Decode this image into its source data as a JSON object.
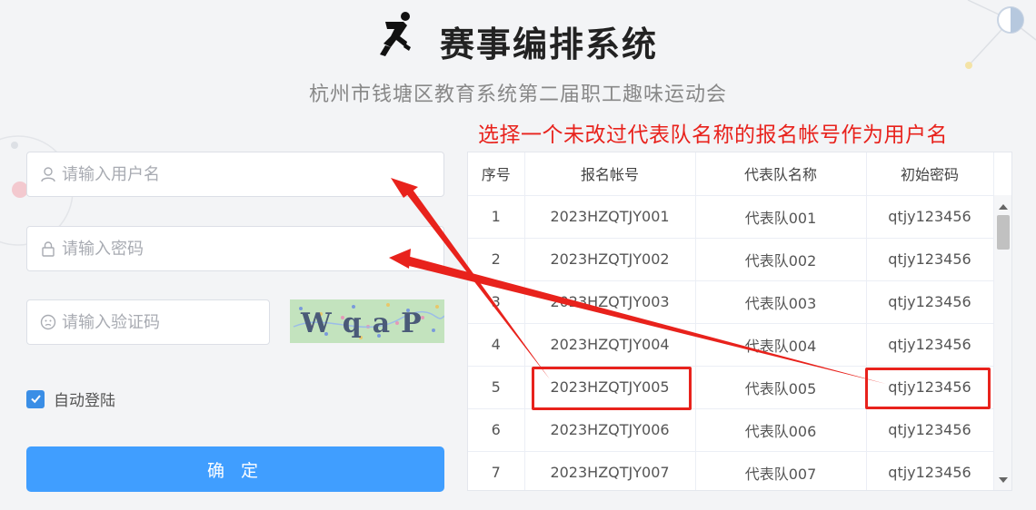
{
  "header": {
    "title": "赛事编排系统",
    "subtitle": "杭州市钱塘区教育系统第二届职工趣味运动会"
  },
  "instruction": "选择一个未改过代表队名称的报名帐号作为用户名",
  "login": {
    "username_placeholder": "请输入用户名",
    "password_placeholder": "请输入密码",
    "captcha_placeholder": "请输入验证码",
    "captcha_text": "WqaP",
    "remember_label": "自动登陆",
    "remember_checked": true,
    "submit_label": "确 定"
  },
  "table": {
    "columns": [
      "序号",
      "报名帐号",
      "代表队名称",
      "初始密码"
    ],
    "rows": [
      [
        "1",
        "2023HZQTJY001",
        "代表队001",
        "qtjy123456"
      ],
      [
        "2",
        "2023HZQTJY002",
        "代表队002",
        "qtjy123456"
      ],
      [
        "3",
        "2023HZQTJY003",
        "代表队003",
        "qtjy123456"
      ],
      [
        "4",
        "2023HZQTJY004",
        "代表队004",
        "qtjy123456"
      ],
      [
        "5",
        "2023HZQTJY005",
        "代表队005",
        "qtjy123456"
      ],
      [
        "6",
        "2023HZQTJY006",
        "代表队006",
        "qtjy123456"
      ],
      [
        "7",
        "2023HZQTJY007",
        "代表队007",
        "qtjy123456"
      ]
    ]
  },
  "colors": {
    "accent": "#409eff",
    "annotation": "#e8221c",
    "checkbox": "#3a8ee6"
  }
}
